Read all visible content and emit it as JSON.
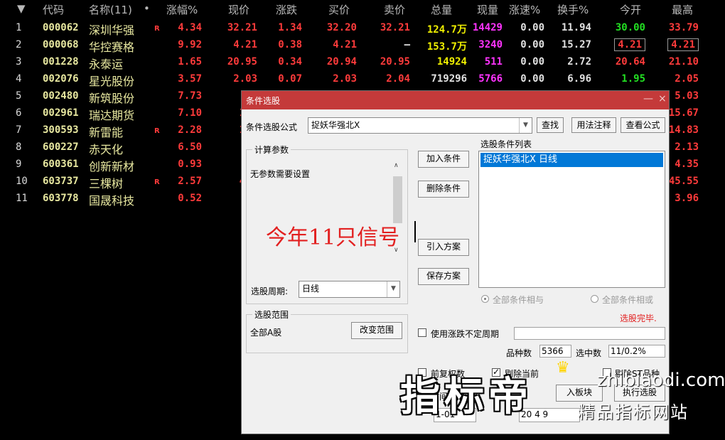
{
  "table": {
    "sort_arrow": "▼",
    "headers": [
      "代码",
      "名称(11)",
      "•",
      "涨幅%",
      "现价",
      "涨跌",
      "买价",
      "卖价",
      "总量",
      "现量",
      "涨速%",
      "换手%",
      "今开",
      "最高"
    ],
    "rows": [
      {
        "idx": "1",
        "code": "000062",
        "name": "深圳华强",
        "r": "R",
        "chg_pct": "4.34",
        "price": "32.21",
        "chg": "1.34",
        "bid": "32.20",
        "ask": "32.21",
        "vol": "124.7万",
        "cur_vol": "14429",
        "speed": "0.00",
        "turnover": "11.94",
        "open": "30.00",
        "high": "33.79"
      },
      {
        "idx": "2",
        "code": "000068",
        "name": "华控赛格",
        "r": "",
        "chg_pct": "9.92",
        "price": "4.21",
        "chg": "0.38",
        "bid": "4.21",
        "ask": "—",
        "vol": "153.7万",
        "cur_vol": "3240",
        "speed": "0.00",
        "turnover": "15.27",
        "open": "4.21",
        "high": "4.21"
      },
      {
        "idx": "3",
        "code": "001228",
        "name": "永泰运",
        "r": "",
        "chg_pct": "1.65",
        "price": "20.95",
        "chg": "0.34",
        "bid": "20.94",
        "ask": "20.95",
        "vol": "14924",
        "cur_vol": "511",
        "speed": "0.00",
        "turnover": "2.72",
        "open": "20.64",
        "high": "21.10"
      },
      {
        "idx": "4",
        "code": "002076",
        "name": "星光股份",
        "r": "",
        "chg_pct": "3.57",
        "price": "2.03",
        "chg": "0.07",
        "bid": "2.03",
        "ask": "2.04",
        "vol": "719296",
        "cur_vol": "5766",
        "speed": "0.00",
        "turnover": "6.96",
        "open": "1.95",
        "high": "2.05"
      },
      {
        "idx": "5",
        "code": "002480",
        "name": "新筑股份",
        "r": "",
        "chg_pct": "7.73",
        "price": "5.",
        "high": "5.03"
      },
      {
        "idx": "6",
        "code": "002961",
        "name": "瑞达期货",
        "r": "",
        "chg_pct": "7.10",
        "price": "15.",
        "high": "15.67"
      },
      {
        "idx": "7",
        "code": "300593",
        "name": "新雷能",
        "r": "R",
        "chg_pct": "2.28",
        "price": "14.",
        "high": "14.83"
      },
      {
        "idx": "8",
        "code": "600227",
        "name": "赤天化",
        "r": "",
        "chg_pct": "6.50",
        "price": "2.",
        "high": "2.13"
      },
      {
        "idx": "9",
        "code": "600361",
        "name": "创新新材",
        "r": "",
        "chg_pct": "0.93",
        "price": "4.",
        "high": "4.35"
      },
      {
        "idx": "10",
        "code": "603737",
        "name": "三棵树",
        "r": "R",
        "chg_pct": "2.57",
        "price": "44.",
        "high": "45.55"
      },
      {
        "idx": "11",
        "code": "603778",
        "name": "国晟科技",
        "r": "",
        "chg_pct": "0.52",
        "price": "3.",
        "high": "3.96"
      }
    ]
  },
  "dialog": {
    "title": "条件选股",
    "minimize": "—",
    "close": "×",
    "formula_label": "条件选股公式",
    "formula_value": "捉妖华强北X",
    "find_button": "查找",
    "usage_button": "用法注释",
    "view_formula_button": "查看公式",
    "params_group": "计算参数",
    "params_text": "无参数需要设置",
    "annotation": "今年11只信号",
    "period_label": "选股周期:",
    "period_value": "日线",
    "add_condition_button": "加入条件",
    "delete_condition_button": "删除条件",
    "import_plan_button": "引入方案",
    "save_plan_button": "保存方案",
    "condition_list_label": "选股条件列表",
    "condition_item": "捉妖华强北X  日线",
    "radio_and": "全部条件相与",
    "radio_or": "全部条件相或",
    "status": "选股完毕.",
    "scope_group": "选股范围",
    "scope_value": "全部A股",
    "change_scope_button": "改变范围",
    "use_period_label": "使用涨跌不定周期",
    "species_label": "品种数",
    "species_value": "5366",
    "selected_label": "选中数",
    "selected_value": "11/0.2%",
    "pre_adjust_label": "前复权数",
    "exclude_current_label": "剔除当前",
    "exclude_st_label": "剔除ST品种",
    "time_range_label": "时间段内",
    "to_block_button": "入板块",
    "execute_button": "执行选股",
    "date_start": "1-01",
    "date_end": "20 4  9"
  },
  "watermark": {
    "big": "指标帝",
    "url": "zhibiaodi.com",
    "sub": "精品指标网站"
  },
  "colors": {
    "title_bar": "#c43a3a",
    "selection": "#0078d7",
    "up": "#ff3b3b",
    "code": "#e8e8a0"
  }
}
